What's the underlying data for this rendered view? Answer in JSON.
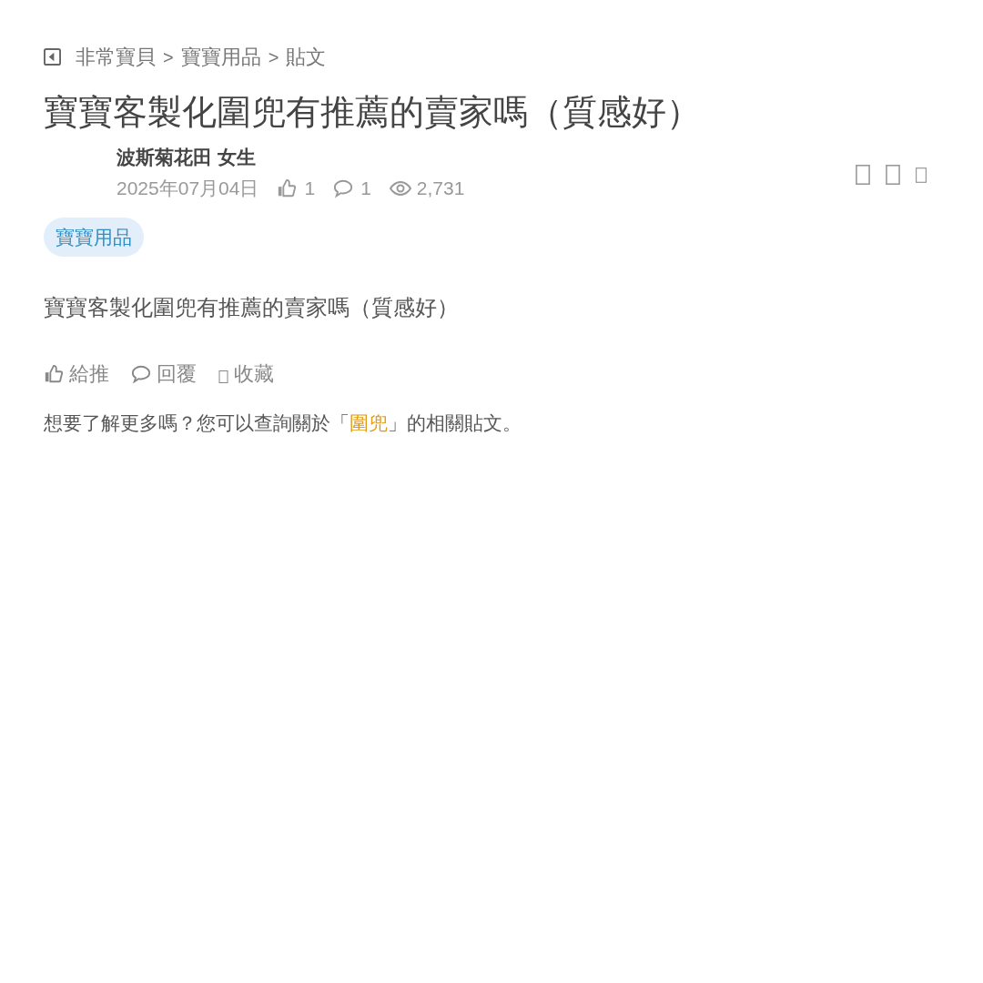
{
  "breadcrumb": [
    {
      "kind": "link",
      "text": "非常寶貝"
    },
    {
      "kind": "separator",
      "text": ">"
    },
    {
      "kind": "link",
      "text": "寶寶用品"
    },
    {
      "kind": "separator",
      "text": ">"
    },
    {
      "kind": "current",
      "text": "貼文"
    }
  ],
  "post": {
    "title": "寶寶客製化圍兜有推薦的賣家嗎（質感好）",
    "author": "波斯菊花田 女生",
    "date": "2025年07月04日",
    "likes": "1",
    "comments": "1",
    "views": "2,731",
    "tag": "寶寶用品",
    "body": "寶寶客製化圍兜有推薦的賣家嗎（質感好）"
  },
  "actions": [
    {
      "kind": "like",
      "label": "給推"
    },
    {
      "kind": "reply",
      "label": "回覆"
    },
    {
      "kind": "save",
      "label": "收藏"
    }
  ],
  "related": {
    "prefix": "想要了解更多嗎？您可以查詢關於「",
    "keyword": "圍兜",
    "suffix": "」的相關貼文。"
  }
}
